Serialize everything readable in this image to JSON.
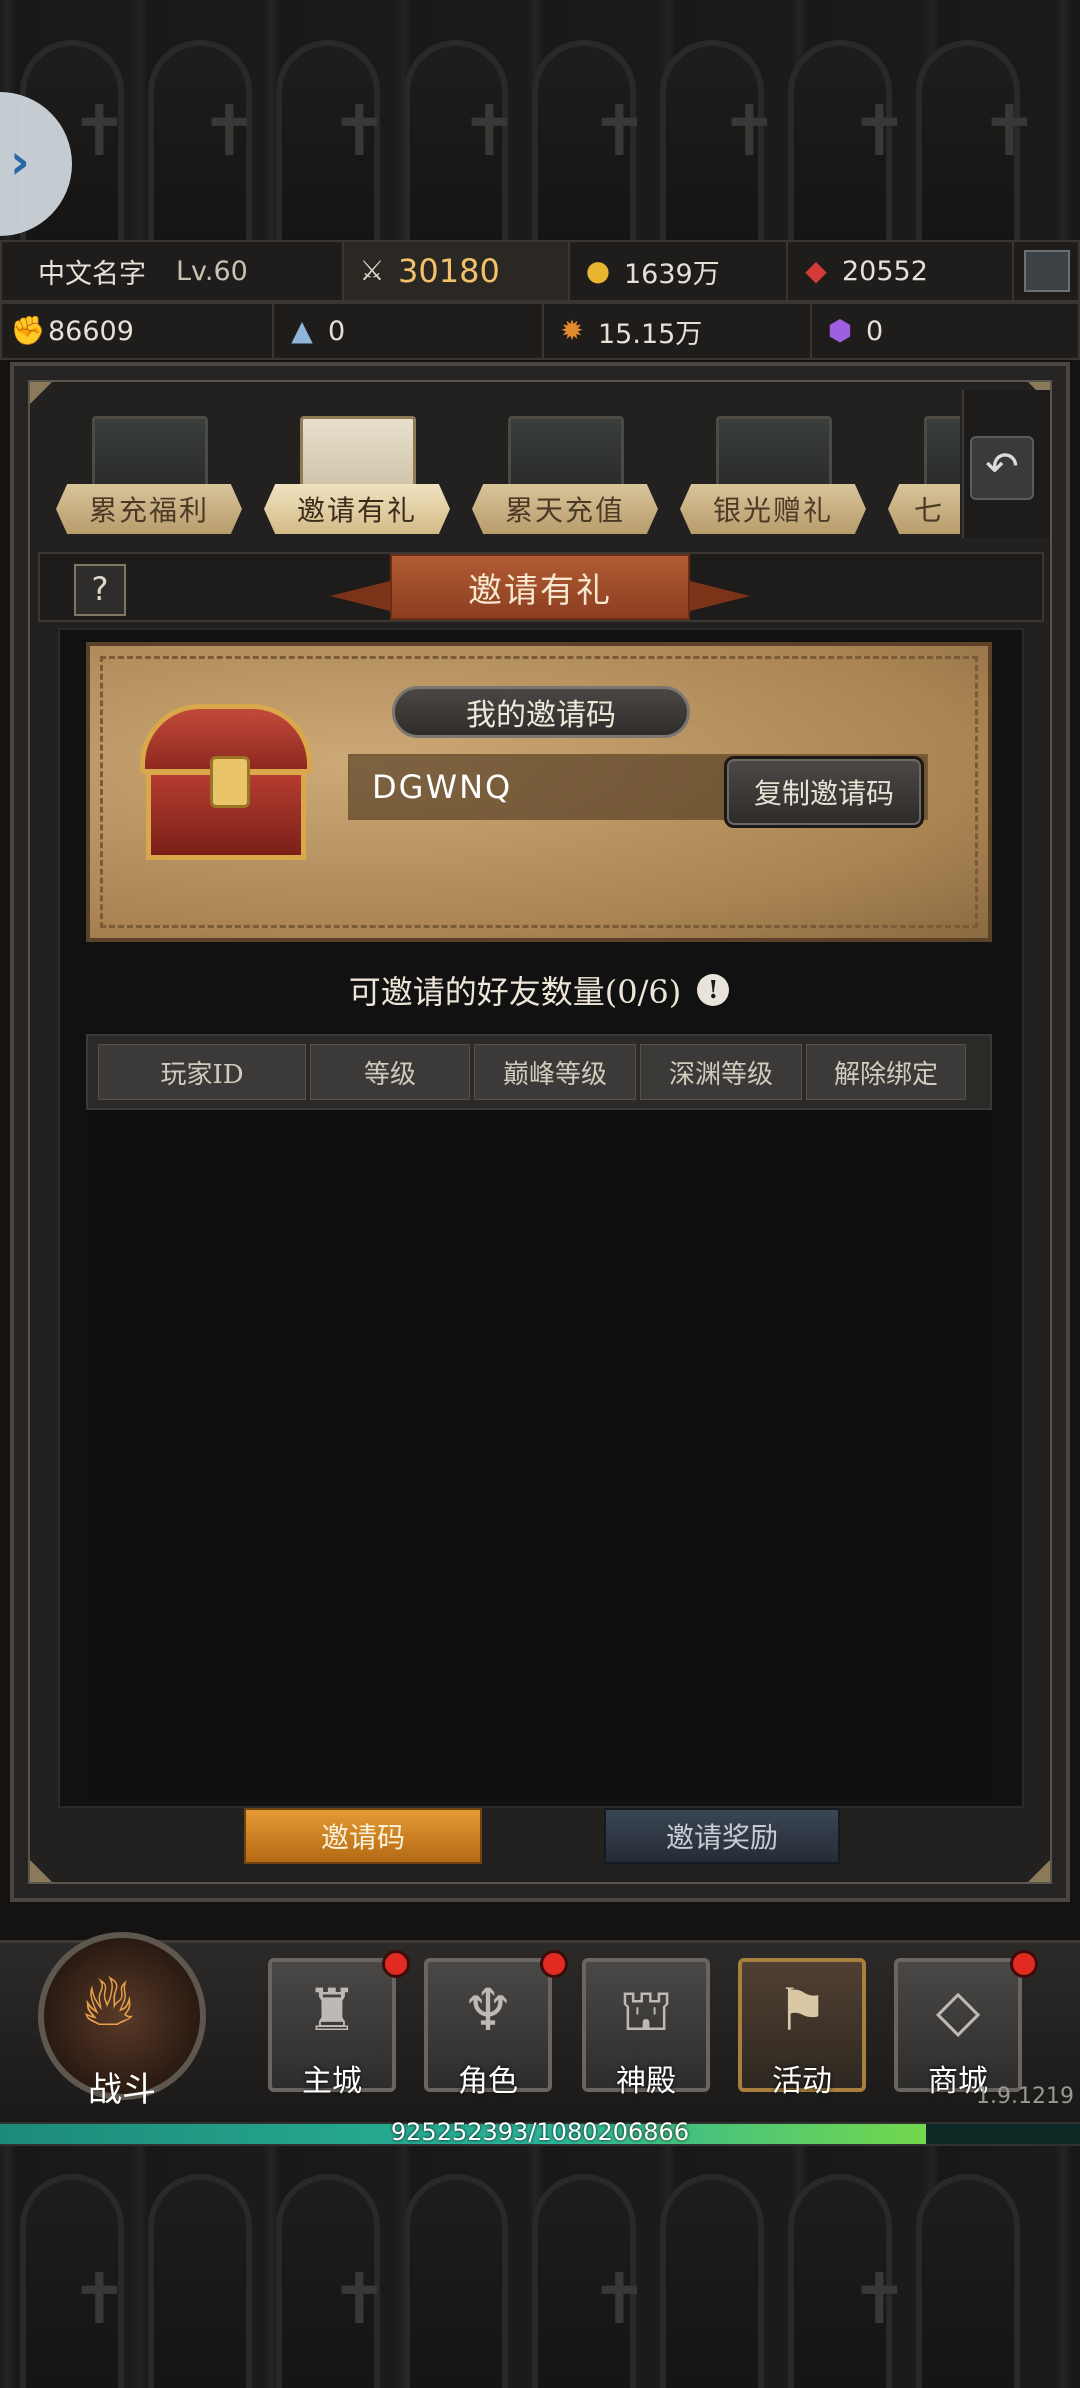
{
  "player": {
    "name": "中文名字",
    "level": "Lv.60"
  },
  "resources_top": [
    {
      "icon": "crossed-swords-icon",
      "value": "30180"
    },
    {
      "icon": "gold-coin-add-icon",
      "value": "1639万"
    },
    {
      "icon": "gem-add-icon",
      "value": "20552"
    }
  ],
  "resources_second": [
    {
      "icon": "fist-icon",
      "value": "86609"
    },
    {
      "icon": "crystal-shard-icon",
      "value": "0"
    },
    {
      "icon": "sun-emblem-icon",
      "value": "15.15万"
    },
    {
      "icon": "purple-gem-icon",
      "value": "0"
    }
  ],
  "tabs": [
    {
      "label": "累充福利",
      "active": false
    },
    {
      "label": "邀请有礼",
      "active": true
    },
    {
      "label": "累天充值",
      "active": false
    },
    {
      "label": "银光赠礼",
      "active": false
    },
    {
      "label": "七",
      "active": false
    }
  ],
  "help_label": "?",
  "panel_title": "邀请有礼",
  "invite": {
    "code_title": "我的邀请码",
    "code": "DGWNQ",
    "copy_button": "复制邀请码"
  },
  "friends": {
    "title": "可邀请的好友数量(0/6)",
    "info": "!",
    "columns": [
      "玩家ID",
      "等级",
      "巅峰等级",
      "深渊等级",
      "解除绑定"
    ],
    "rows": []
  },
  "bottom_tabs": {
    "invite_code": "邀请码",
    "invite_reward": "邀请奖励"
  },
  "nav": {
    "battle": "战斗",
    "items": [
      {
        "label": "主城",
        "icon": "castle-icon",
        "badge": true,
        "active": false
      },
      {
        "label": "角色",
        "icon": "horned-helmet-icon",
        "badge": true,
        "active": false
      },
      {
        "label": "神殿",
        "icon": "temple-icon",
        "badge": false,
        "active": false
      },
      {
        "label": "活动",
        "icon": "banner-icon",
        "badge": false,
        "active": true
      },
      {
        "label": "商城",
        "icon": "diamond-icon",
        "badge": true,
        "active": false
      }
    ]
  },
  "version": "1.9.1219",
  "experience": {
    "text": "925252393/1080206866",
    "progress": 0.857
  },
  "colors": {
    "accent_orange": "#d8891f",
    "badge_red": "#e02a22",
    "xp_green": "#2bb59a"
  }
}
